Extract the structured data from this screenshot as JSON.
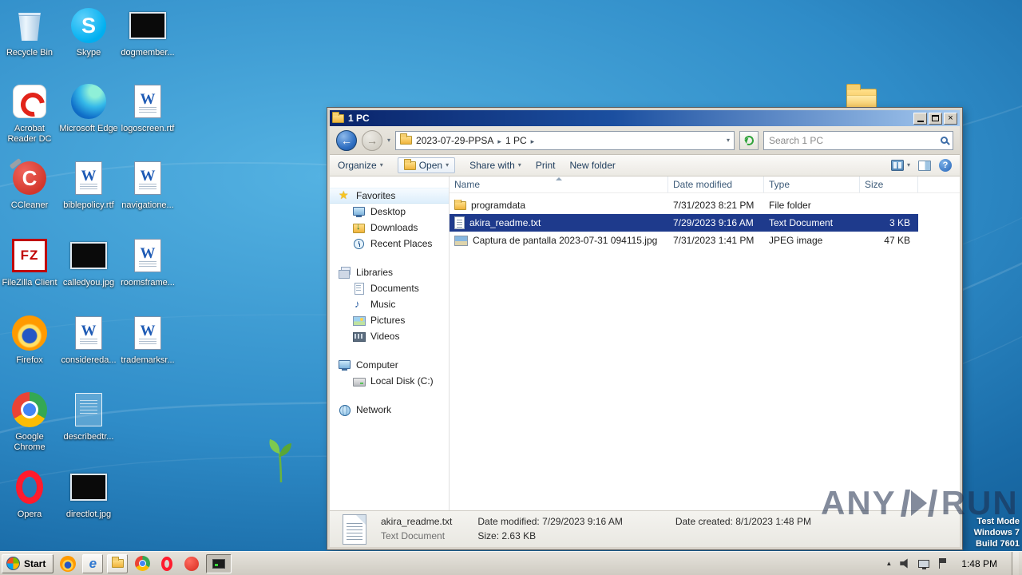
{
  "colors": {
    "selection": "#1e3a8c",
    "titlebar_start": "#0a246a",
    "titlebar_mid": "#1b4fa0",
    "titlebar_end": "#a6caf0",
    "desktop_light": "#54b2e2",
    "desktop_dark": "#0d4f85",
    "taskbar_face": "#e6e3dc",
    "watermark": "rgba(30,44,74,0.55)"
  },
  "desktop": {
    "icons": [
      {
        "label": "Recycle Bin"
      },
      {
        "label": "Acrobat Reader DC"
      },
      {
        "label": "CCleaner"
      },
      {
        "label": "FileZilla Client"
      },
      {
        "label": "Firefox"
      },
      {
        "label": "Google Chrome"
      },
      {
        "label": "Opera"
      },
      {
        "label": "Skype"
      },
      {
        "label": "Microsoft Edge"
      },
      {
        "label": "biblepolicy.rtf"
      },
      {
        "label": "calledyou.jpg"
      },
      {
        "label": "considereda..."
      },
      {
        "label": "describedtr..."
      },
      {
        "label": "directlot.jpg"
      },
      {
        "label": "dogmember..."
      },
      {
        "label": "logoscreen.rtf"
      },
      {
        "label": "navigatione..."
      },
      {
        "label": "roomsframe..."
      },
      {
        "label": "trademarksr..."
      }
    ]
  },
  "window": {
    "title": "1 PC",
    "breadcrumb": {
      "items": [
        "2023-07-29-PPSA",
        "1 PC"
      ]
    },
    "search": {
      "placeholder": "Search 1 PC"
    },
    "commandbar": {
      "organize": "Organize",
      "open": "Open",
      "share": "Share with",
      "print": "Print",
      "new_folder": "New folder"
    },
    "sidebar": {
      "favorites": {
        "label": "Favorites",
        "items": [
          "Desktop",
          "Downloads",
          "Recent Places"
        ]
      },
      "libraries": {
        "label": "Libraries",
        "items": [
          "Documents",
          "Music",
          "Pictures",
          "Videos"
        ]
      },
      "computer": {
        "label": "Computer",
        "items": [
          "Local Disk (C:)"
        ]
      },
      "network": {
        "label": "Network"
      }
    },
    "list": {
      "columns": [
        "Name",
        "Date modified",
        "Type",
        "Size"
      ],
      "rows": [
        {
          "name": "programdata",
          "date_modified": "7/31/2023 8:21 PM",
          "type": "File folder",
          "size": ""
        },
        {
          "name": "akira_readme.txt",
          "date_modified": "7/29/2023 9:16 AM",
          "type": "Text Document",
          "size": "3 KB"
        },
        {
          "name": "Captura de pantalla 2023-07-31 094115.jpg",
          "date_modified": "7/31/2023 1:41 PM",
          "type": "JPEG image",
          "size": "47 KB"
        }
      ]
    },
    "details": {
      "filename": "akira_readme.txt",
      "filetype": "Text Document",
      "date_modified": "Date modified: 7/29/2023 9:16 AM",
      "size": "Size: 2.63 KB",
      "date_created": "Date created: 8/1/2023 1:48 PM"
    }
  },
  "taskbar": {
    "start": "Start",
    "clock": "1:48 PM"
  },
  "watermark": {
    "brand_left": "ANY",
    "brand_right": "RUN",
    "lines": [
      "Test Mode",
      "Windows 7",
      "Build 7601"
    ]
  }
}
